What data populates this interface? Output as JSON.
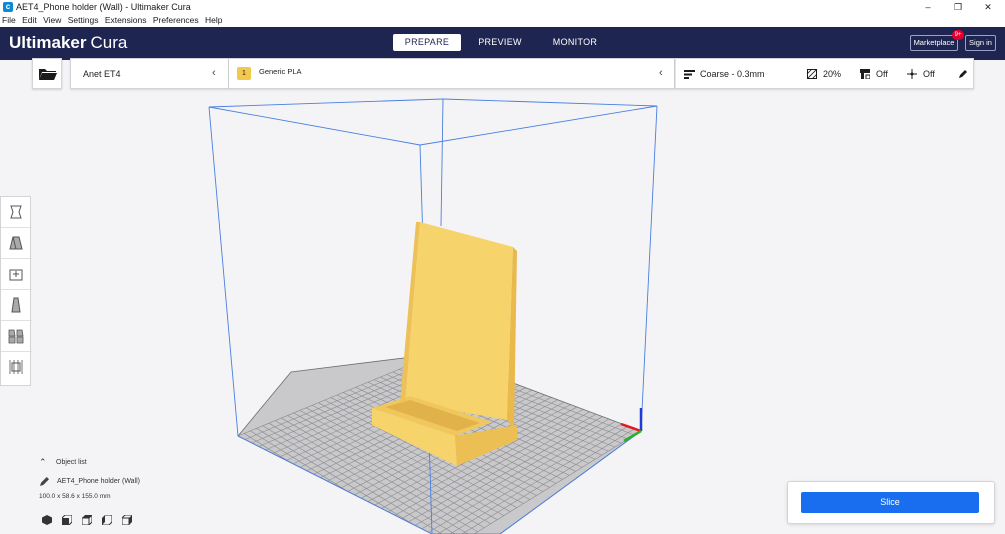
{
  "window": {
    "title": "AET4_Phone holder (Wall) - Ultimaker Cura",
    "app_icon": "cura-icon",
    "minimize_label": "–",
    "maximize_label": "❐",
    "close_label": "✕"
  },
  "menu": [
    "File",
    "Edit",
    "View",
    "Settings",
    "Extensions",
    "Preferences",
    "Help"
  ],
  "header": {
    "brand": "Ultimaker",
    "product": "Cura",
    "tabs": [
      {
        "label": "PREPARE",
        "active": true
      },
      {
        "label": "PREVIEW",
        "active": false
      },
      {
        "label": "MONITOR",
        "active": false
      }
    ],
    "marketplace_label": "Marketplace",
    "marketplace_badge": "9+",
    "sign_in_label": "Sign in"
  },
  "stage": {
    "printer": "Anet ET4",
    "extruder_number": "1",
    "material": "Generic PLA",
    "profile": "Coarse - 0.3mm",
    "infill": "20%",
    "support": "Off",
    "adhesion": "Off"
  },
  "tools": [
    "move-tool-icon",
    "scale-tool-icon",
    "rotate-tool-icon",
    "mirror-tool-icon",
    "per-model-settings-icon",
    "support-blocker-icon"
  ],
  "object_list": {
    "header": "Object list",
    "object_name": "AET4_Phone holder (Wall)",
    "dimensions": "100.0 x 58.6 x 155.0 mm"
  },
  "view_buttons": [
    "3d-view-icon",
    "front-view-icon",
    "top-view-icon",
    "left-view-icon",
    "right-view-icon"
  ],
  "slice": {
    "label": "Slice"
  },
  "colors": {
    "header_bg": "#1f2551",
    "accent": "#196ef0",
    "model": "#f7d46a",
    "build_volume": "#4a7fe0"
  }
}
